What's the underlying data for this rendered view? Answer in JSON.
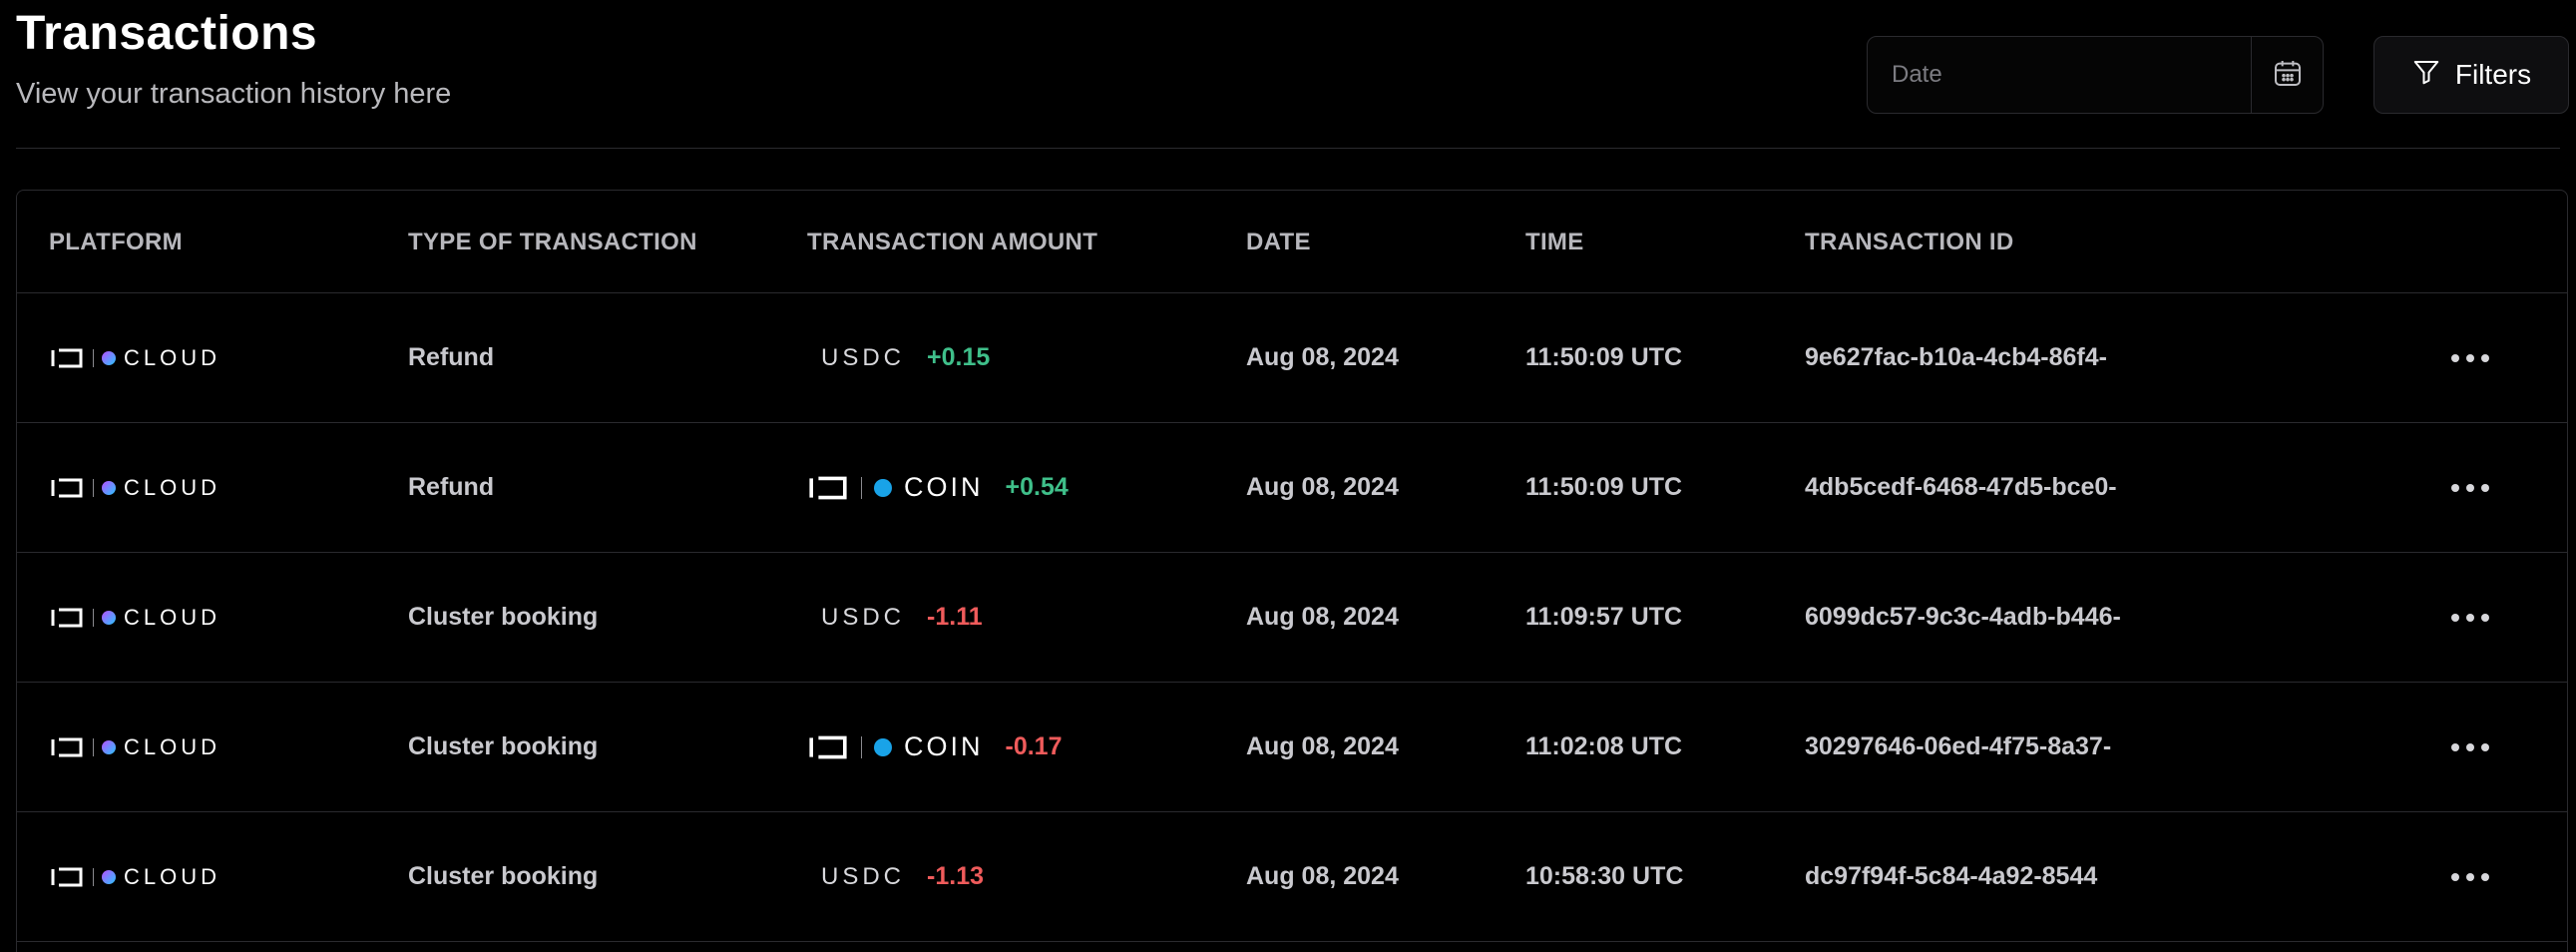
{
  "header": {
    "title": "Transactions",
    "subtitle": "View your transaction history here",
    "date_placeholder": "Date",
    "filters_label": "Filters"
  },
  "columns": {
    "platform": "PLATFORM",
    "type": "TYPE OF TRANSACTION",
    "amount": "TRANSACTION AMOUNT",
    "date": "DATE",
    "time": "TIME",
    "txid": "TRANSACTION ID"
  },
  "platform_logo": {
    "brand": "IO",
    "product": "CLOUD"
  },
  "rows": [
    {
      "type": "Refund",
      "currency": "USDC",
      "amount": "+0.15",
      "sign": "positive",
      "date": "Aug 08, 2024",
      "time": "11:50:09 UTC",
      "txid": "9e627fac-b10a-4cb4-86f4-"
    },
    {
      "type": "Refund",
      "currency": "IO COIN",
      "amount": "+0.54",
      "sign": "positive",
      "date": "Aug 08, 2024",
      "time": "11:50:09 UTC",
      "txid": "4db5cedf-6468-47d5-bce0-"
    },
    {
      "type": "Cluster booking",
      "currency": "USDC",
      "amount": "-1.11",
      "sign": "negative",
      "date": "Aug 08, 2024",
      "time": "11:09:57 UTC",
      "txid": "6099dc57-9c3c-4adb-b446-"
    },
    {
      "type": "Cluster booking",
      "currency": "IO COIN",
      "amount": "-0.17",
      "sign": "negative",
      "date": "Aug 08, 2024",
      "time": "11:02:08 UTC",
      "txid": "30297646-06ed-4f75-8a37-"
    },
    {
      "type": "Cluster booking",
      "currency": "USDC",
      "amount": "-1.13",
      "sign": "negative",
      "date": "Aug 08, 2024",
      "time": "10:58:30 UTC",
      "txid": "dc97f94f-5c84-4a92-8544"
    }
  ],
  "colors": {
    "positive": "#3fbf8a",
    "negative": "#ef5b5b",
    "cloud_gradient_start": "#b84dff",
    "cloud_gradient_end": "#29c6ff",
    "coin_dot": "#19a3e8"
  },
  "icons": {
    "date_button": "calendar-icon",
    "filters_button": "filter-icon",
    "row_actions": "more-horizontal-icon"
  }
}
